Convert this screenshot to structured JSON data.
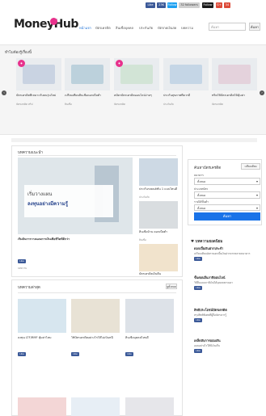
{
  "topbar": {
    "chips": [
      {
        "label": "Like",
        "color": "#3b5998"
      },
      {
        "label": "23K",
        "color": "#3b5998"
      },
      {
        "label": "Follow",
        "color": "#1da1f2"
      },
      {
        "label": "32 followers",
        "color": "#cfcfcf"
      },
      {
        "label": "Follow",
        "color": "#1a1a1a"
      },
      {
        "label": "G+",
        "color": "#dd4b39"
      },
      {
        "label": "34",
        "color": "#dd4b39"
      }
    ]
  },
  "header": {
    "logo": "MoneyHub",
    "nav": [
      "หน้าแรก",
      "บัตรเครดิต",
      "สินเชื่อบุคคล",
      "ประกันภัย",
      "บัตรกดเงินสด",
      "บทความ"
    ],
    "search_placeholder": "ค้นหา",
    "search_button": "ค้นหา"
  },
  "featured": {
    "title": "ทำไมต้องรู้เรื่องนี้",
    "cards": [
      {
        "title": "บัตรเครดิตที่เหมาะกับคนรุ่นใหม่",
        "meta": "บัตรเครดิต ทริป"
      },
      {
        "title": "เปรียบเทียบสินเชื่อดอกเบี้ยต่ำ",
        "meta": "สินเชื่อ"
      },
      {
        "title": "สมัครบัตรเครดิตออนไลน์ง่ายๆ",
        "meta": "บัตรเครดิต"
      },
      {
        "title": "ประกันสุขภาพที่ควรมี",
        "meta": "ประกันภัย"
      },
      {
        "title": "ทริคใช้บัตรเครดิตให้คุ้มค่า",
        "meta": "บัตรเครดิต"
      }
    ]
  },
  "latest": {
    "title": "บทความแนะนำ",
    "main": {
      "headline": "เริ่มต้นการวางแผนการเงินเพื่อชีวิตที่ดีกว่า",
      "sign_a": "เริ่มวางแผน",
      "sign_b": "ลงทุนอย่างมีความรู้",
      "meta": "บทความ"
    },
    "side": [
      {
        "title": "ประกันรถยนต์ชั้น 1 แบบไหนดี",
        "meta": "ประกันภัย"
      },
      {
        "title": "สินเชื่อบ้าน ดอกเบี้ยต่ำ",
        "meta": "สินเชื่อ"
      },
      {
        "title": "บัตรเครดิตเงินคืน",
        "meta": "บัตรเครดิต"
      }
    ]
  },
  "filter": {
    "title": "ค้นหาบัตรเครดิต",
    "compare_button": "เปรียบเทียบ",
    "fields": [
      {
        "label": "ธนาคาร",
        "value": "ทั้งหมด"
      },
      {
        "label": "ประเภทบัตร",
        "value": "ทั้งหมด"
      },
      {
        "label": "รายได้ขั้นต่ำ",
        "value": "ทั้งหมด"
      }
    ],
    "submit": "ค้นหา"
  },
  "popular": {
    "title": "บทความยอดนิยม",
    "items": [
      {
        "title": "ดอกเบี้ยเงินฝากประจำ",
        "desc": "เปรียบเทียบอัตราดอกเบี้ยเงินฝากจากหลายธนาคาร"
      },
      {
        "title": "ขั้นตอนยื่นภาษีออนไลน์",
        "desc": "วิธียื่นแบบภาษีเงินได้บุคคลธรรมดา"
      },
      {
        "title": "สิทธิประโยชน์บัตรเครดิต",
        "desc": "สรุปสิทธิพิเศษที่ผู้ถือบัตรควรรู้"
      },
      {
        "title": "เคล็ดลับการออมเงิน",
        "desc": "ออมอย่างไรให้มีเงินเก็บ"
      }
    ]
  },
  "recent": {
    "title": "บทความล่าสุด",
    "more": "ดูทั้งหมด",
    "cards": [
      {
        "title": "ลงทุน LTF/RMF คุ้มค่าไหม",
        "meta": "บทความ"
      },
      {
        "title": "ใช้บัตรเครดิตอย่างไรให้ไม่เป็นหนี้",
        "meta": "บัตรเครดิต"
      },
      {
        "title": "สินเชื่อบุคคลไหนดี",
        "meta": "สินเชื่อ"
      }
    ]
  }
}
